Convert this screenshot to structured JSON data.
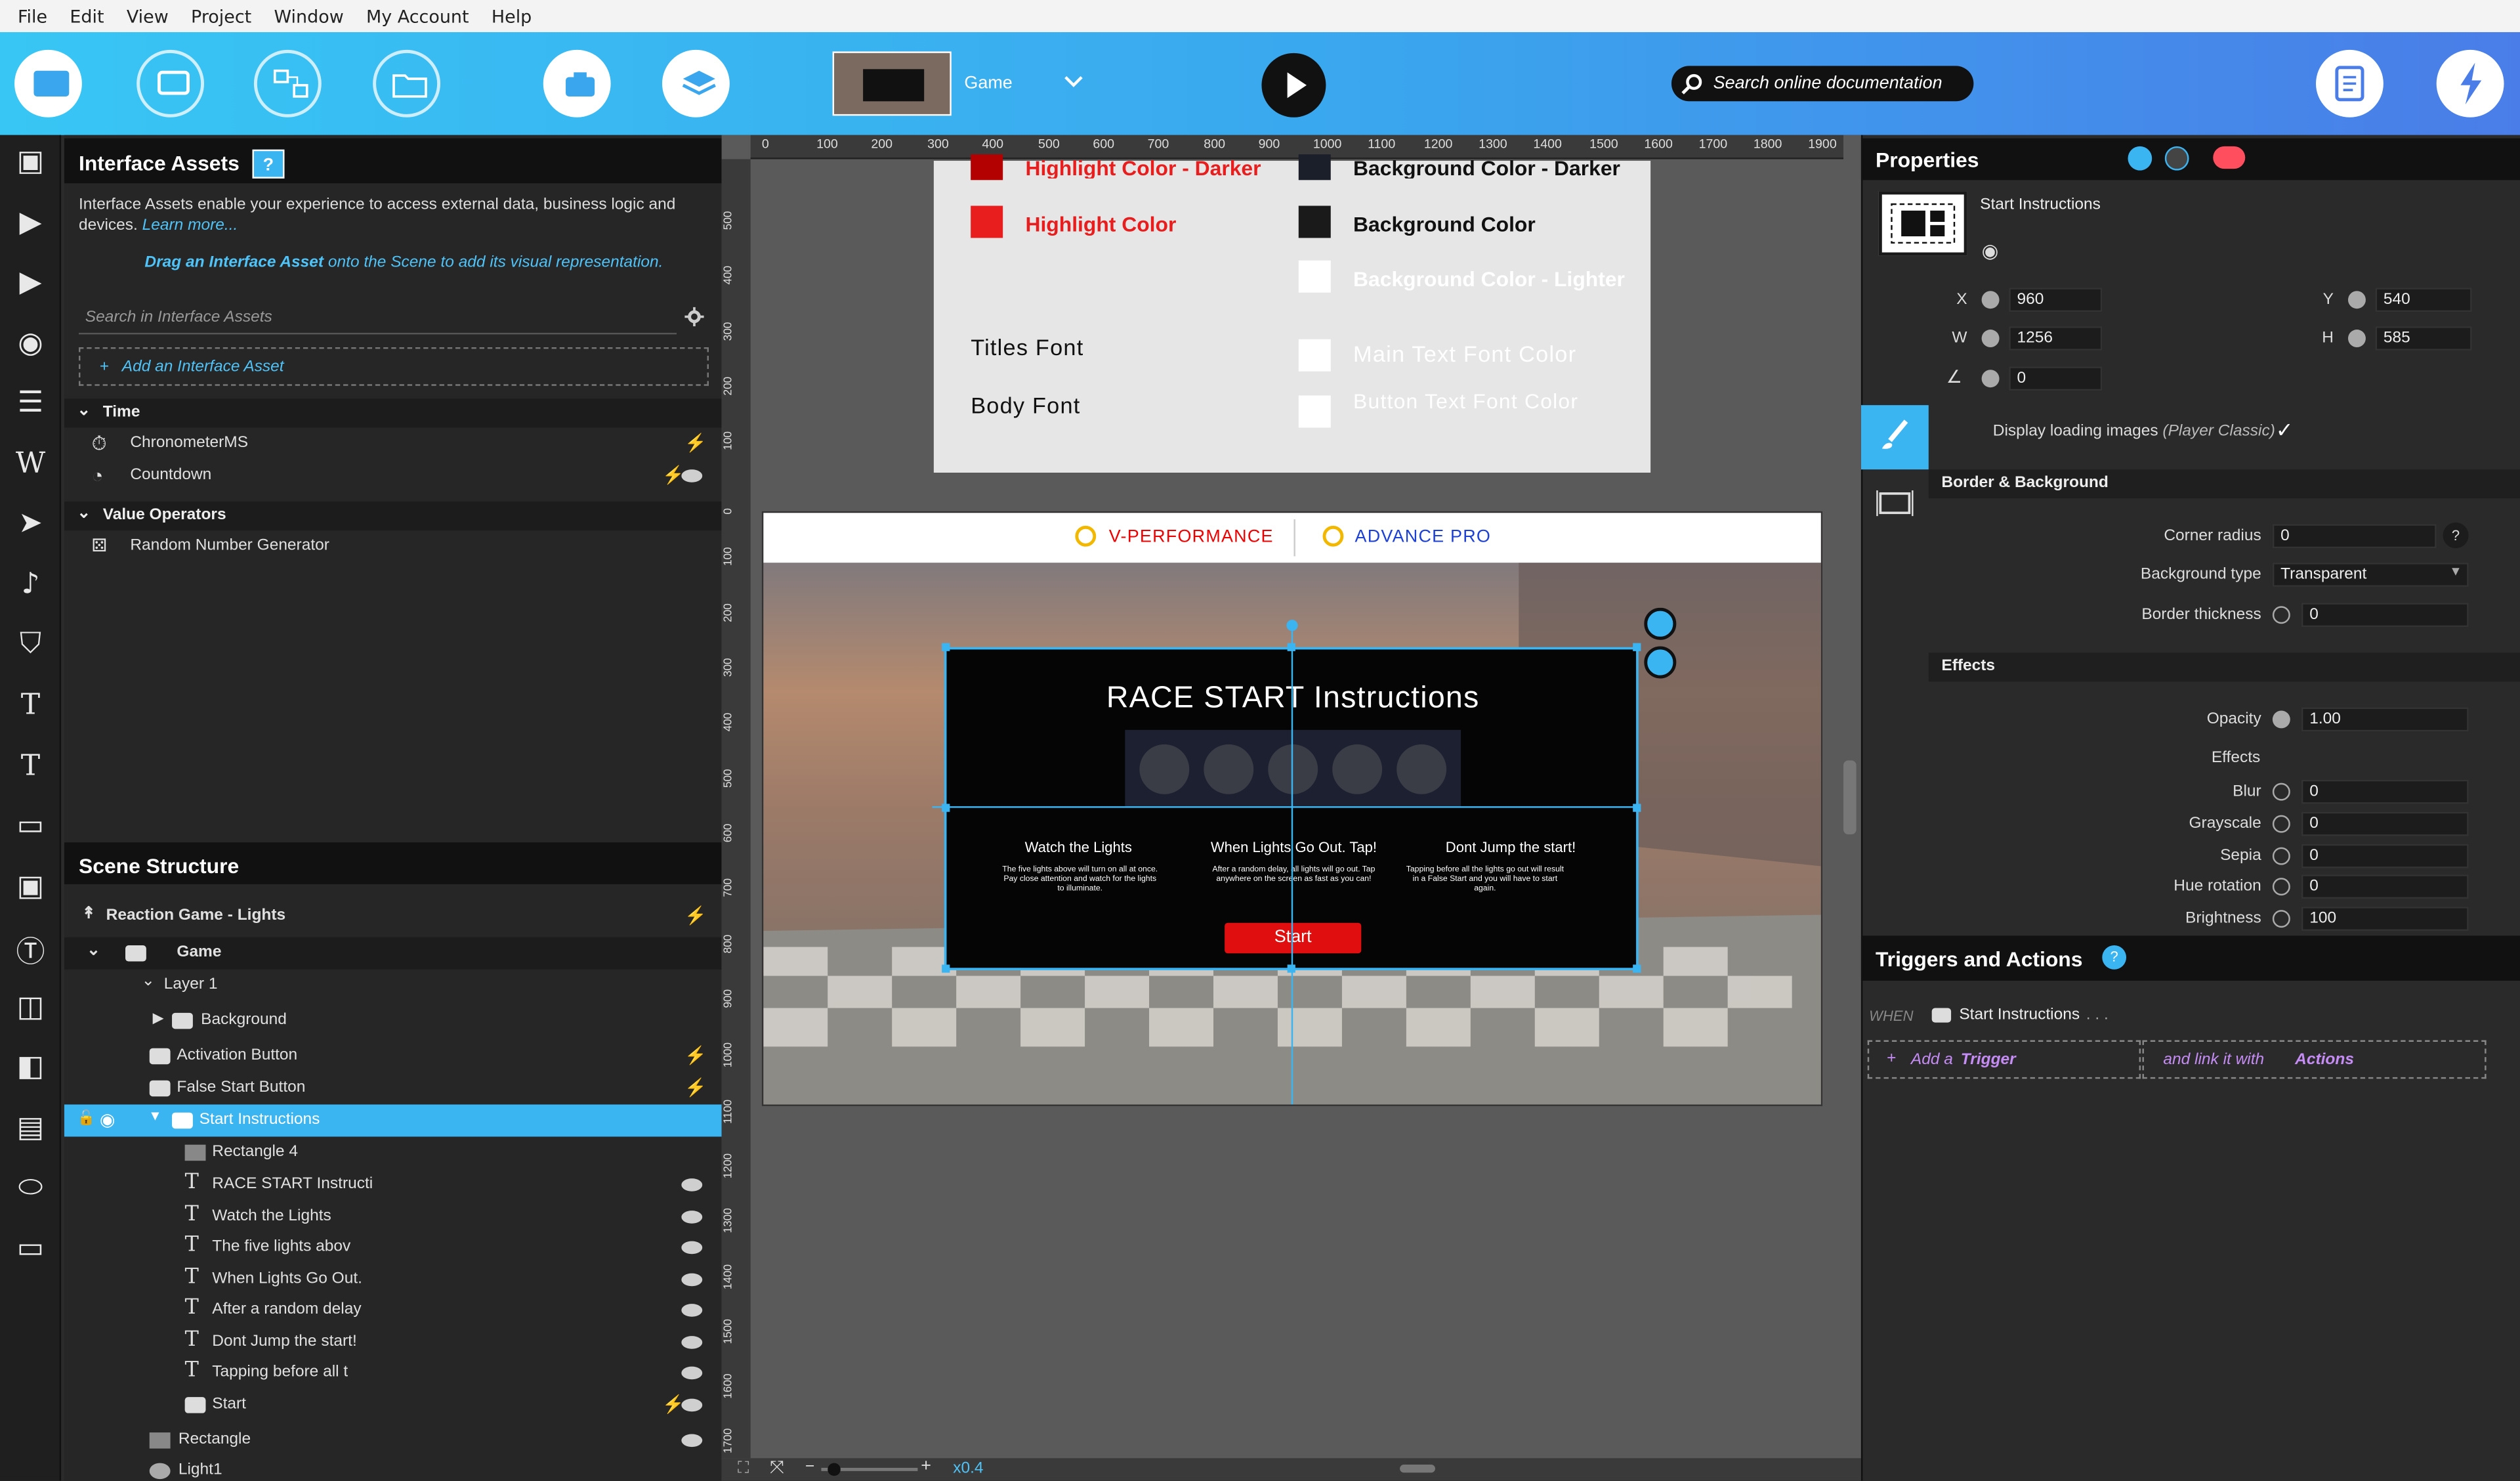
{
  "menu": [
    "File",
    "Edit",
    "View",
    "Project",
    "Window",
    "My Account",
    "Help"
  ],
  "toolbar": {
    "scene_name": "Game",
    "search_placeholder": "Search online documentation"
  },
  "assets": {
    "title": "Interface Assets",
    "help": "?",
    "intro": "Interface Assets enable your experience to access external data, business logic and devices.",
    "learn_more": "Learn more...",
    "drag_strong": "Drag an Interface Asset",
    "drag_rest": "onto the Scene to add its visual representation.",
    "search_placeholder": "Search in Interface Assets",
    "add_label": "Add an Interface Asset",
    "categories": [
      {
        "name": "Time",
        "items": [
          "ChronometerMS",
          "Countdown"
        ]
      },
      {
        "name": "Value Operators",
        "items": [
          "Random Number Generator"
        ]
      }
    ]
  },
  "scene_structure": {
    "title": "Scene Structure",
    "project": "Reaction Game - Lights",
    "rows": [
      "Game",
      "Layer 1",
      "Background",
      "Activation Button",
      "False Start Button",
      "Start Instructions",
      "Rectangle 4",
      "RACE START Instructi",
      "Watch the Lights",
      "The five lights abov",
      "When Lights Go Out.",
      "After a random delay",
      "Dont Jump the start!",
      "Tapping before all t",
      "Start",
      "Rectangle",
      "Light1"
    ]
  },
  "ruler": {
    "h": [
      "0",
      "100",
      "200",
      "300",
      "400",
      "500",
      "600",
      "700",
      "800",
      "900",
      "1000",
      "1100",
      "1200",
      "1300",
      "1400",
      "1500",
      "1600",
      "1700",
      "1800",
      "1900"
    ],
    "v": [
      "500",
      "400",
      "300",
      "200",
      "100",
      "0",
      "100",
      "200",
      "300",
      "400",
      "500",
      "600",
      "700",
      "800",
      "900",
      "1000",
      "1100",
      "1200",
      "1300",
      "1400",
      "1500",
      "1600",
      "1700"
    ]
  },
  "style_card": {
    "left": [
      "Highlight Color - Darker",
      "Highlight Color"
    ],
    "right": [
      "Background Color - Darker",
      "Background Color",
      "Background Color - Lighter"
    ],
    "fonts": [
      "Titles Font",
      "Body Font"
    ],
    "font_colors": [
      "Main Text Font Color",
      "Button Text Font Color"
    ],
    "colors": {
      "highlight_darker": "#b30000",
      "highlight": "#e81e1e",
      "bg_darker": "#1b1f2a",
      "bg": "#1a1a1a",
      "white": "#ffffff"
    }
  },
  "stage": {
    "brand1": "V-PERFORMANCE",
    "brand2": "ADVANCE PRO",
    "title": "RACE START Instructions",
    "cols": [
      {
        "h": "Watch the Lights",
        "b": "The five lights above will turn on all at once. Pay close attention and watch for the lights to illuminate."
      },
      {
        "h": "When Lights Go Out. Tap!",
        "b": "After a random delay, all lights will go out. Tap anywhere on the screen as fast as you can!"
      },
      {
        "h": "Dont Jump the start!",
        "b": "Tapping before all the lights go out will result in a False Start and you will have to start again."
      }
    ],
    "start": "Start"
  },
  "zoom": "x0.4",
  "properties": {
    "title": "Properties",
    "object": "Start Instructions",
    "x": "960",
    "y": "540",
    "w": "1256",
    "h": "585",
    "angle": "0",
    "loading_label": "Display loading images",
    "loading_note": "(Player Classic)",
    "border_bg": "Border & Background",
    "corner_radius_label": "Corner radius",
    "corner_radius": "0",
    "bg_type_label": "Background type",
    "bg_type": "Transparent",
    "border_thickness_label": "Border thickness",
    "border_thickness": "0",
    "effects_head": "Effects",
    "opacity_label": "Opacity",
    "opacity": "1.00",
    "effects_sub": "Effects",
    "effects": [
      {
        "label": "Blur",
        "value": "0"
      },
      {
        "label": "Grayscale",
        "value": "0"
      },
      {
        "label": "Sepia",
        "value": "0"
      },
      {
        "label": "Hue rotation",
        "value": "0"
      },
      {
        "label": "Brightness",
        "value": "100"
      }
    ]
  },
  "triggers": {
    "title": "Triggers and Actions",
    "when": "WHEN",
    "object": "Start Instructions",
    "dots": ". . .",
    "add": "Add a",
    "trigger": "Trigger",
    "link": "and link it with",
    "actions": "Actions"
  }
}
